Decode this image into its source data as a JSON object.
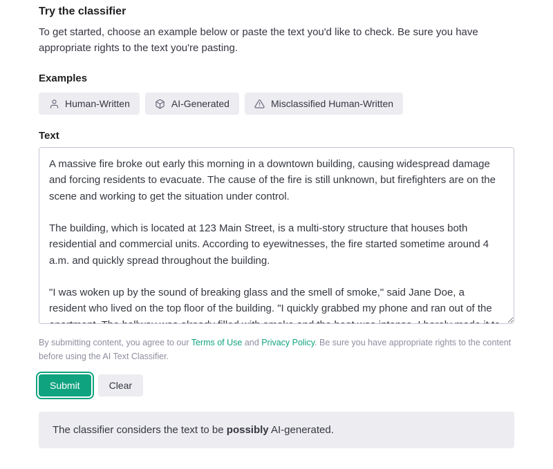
{
  "header": {
    "title": "Try the classifier",
    "intro": "To get started, choose an example below or paste the text you'd like to check. Be sure you have appropriate rights to the text you're pasting."
  },
  "examples": {
    "title": "Examples",
    "items": [
      {
        "label": "Human-Written"
      },
      {
        "label": "AI-Generated"
      },
      {
        "label": "Misclassified Human-Written"
      }
    ]
  },
  "textarea": {
    "label": "Text",
    "value": "A massive fire broke out early this morning in a downtown building, causing widespread damage and forcing residents to evacuate. The cause of the fire is still unknown, but firefighters are on the scene and working to get the situation under control.\n\nThe building, which is located at 123 Main Street, is a multi-story structure that houses both residential and commercial units. According to eyewitnesses, the fire started sometime around 4 a.m. and quickly spread throughout the building.\n\n\"I was woken up by the sound of breaking glass and the smell of smoke,\" said Jane Doe, a resident who lived on the top floor of the building. \"I quickly grabbed my phone and ran out of the apartment. The hallway was already filled with smoke and the heat was intense. I barely made it to the fire escape.\""
  },
  "disclaimer": {
    "prefix": "By submitting content, you agree to our ",
    "terms_label": "Terms of Use",
    "middle": " and ",
    "privacy_label": "Privacy Policy",
    "suffix": ". Be sure you have appropriate rights to the content before using the AI Text Classifier."
  },
  "buttons": {
    "submit": "Submit",
    "clear": "Clear"
  },
  "result": {
    "prefix": "The classifier considers the text to be ",
    "verdict": "possibly",
    "suffix": " AI-generated."
  }
}
